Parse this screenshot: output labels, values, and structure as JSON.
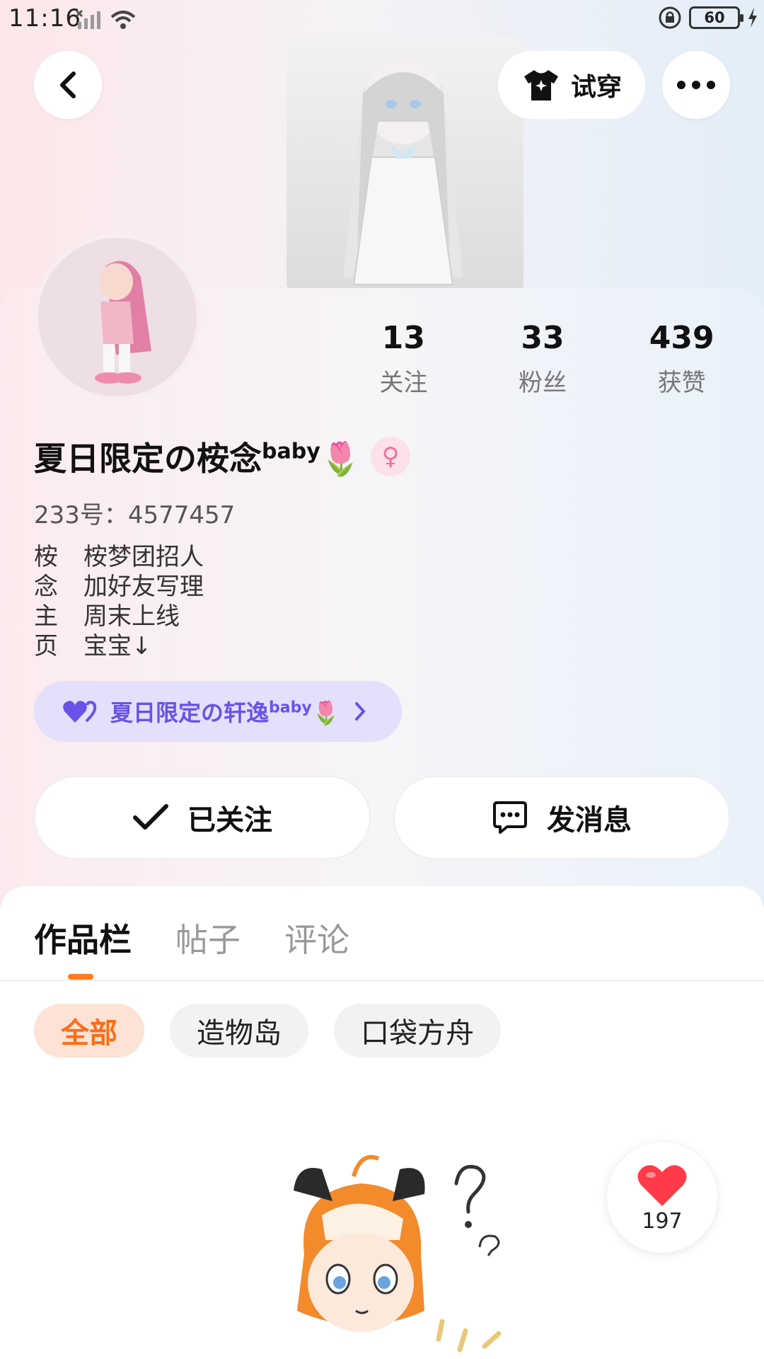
{
  "status_bar": {
    "time": "11:16",
    "battery": "60"
  },
  "header": {
    "tryon_label": "试穿"
  },
  "profile": {
    "following_count": "13",
    "following_label": "关注",
    "fans_count": "33",
    "fans_label": "粉丝",
    "likes_count": "439",
    "likes_label": "获赞",
    "name": "夏日限定の桉念",
    "name_sup": "baby",
    "name_emoji": "🌷",
    "gender_symbol": "♀",
    "uid": "233号：4577457",
    "bio": [
      {
        "prefix": "桉",
        "text": "桉梦团招人"
      },
      {
        "prefix": "念",
        "text": "加好友写理"
      },
      {
        "prefix": "主",
        "text": "周末上线"
      },
      {
        "prefix": "页",
        "text": "宝宝↓"
      }
    ],
    "club_chip": {
      "label": "夏日限定の轩逸",
      "sup": "baby",
      "emoji": "🌷"
    }
  },
  "actions": {
    "follow_label": "已关注",
    "message_label": "发消息"
  },
  "tabs": [
    {
      "label": "作品栏",
      "active": true
    },
    {
      "label": "帖子",
      "active": false
    },
    {
      "label": "评论",
      "active": false
    }
  ],
  "filters": [
    {
      "label": "全部",
      "active": true
    },
    {
      "label": "造物岛",
      "active": false
    },
    {
      "label": "口袋方舟",
      "active": false
    }
  ],
  "like_float": {
    "count": "197"
  },
  "colors": {
    "accent": "#ff7a1a",
    "club": "#6a52e8",
    "heart": "#ff3b4a"
  }
}
